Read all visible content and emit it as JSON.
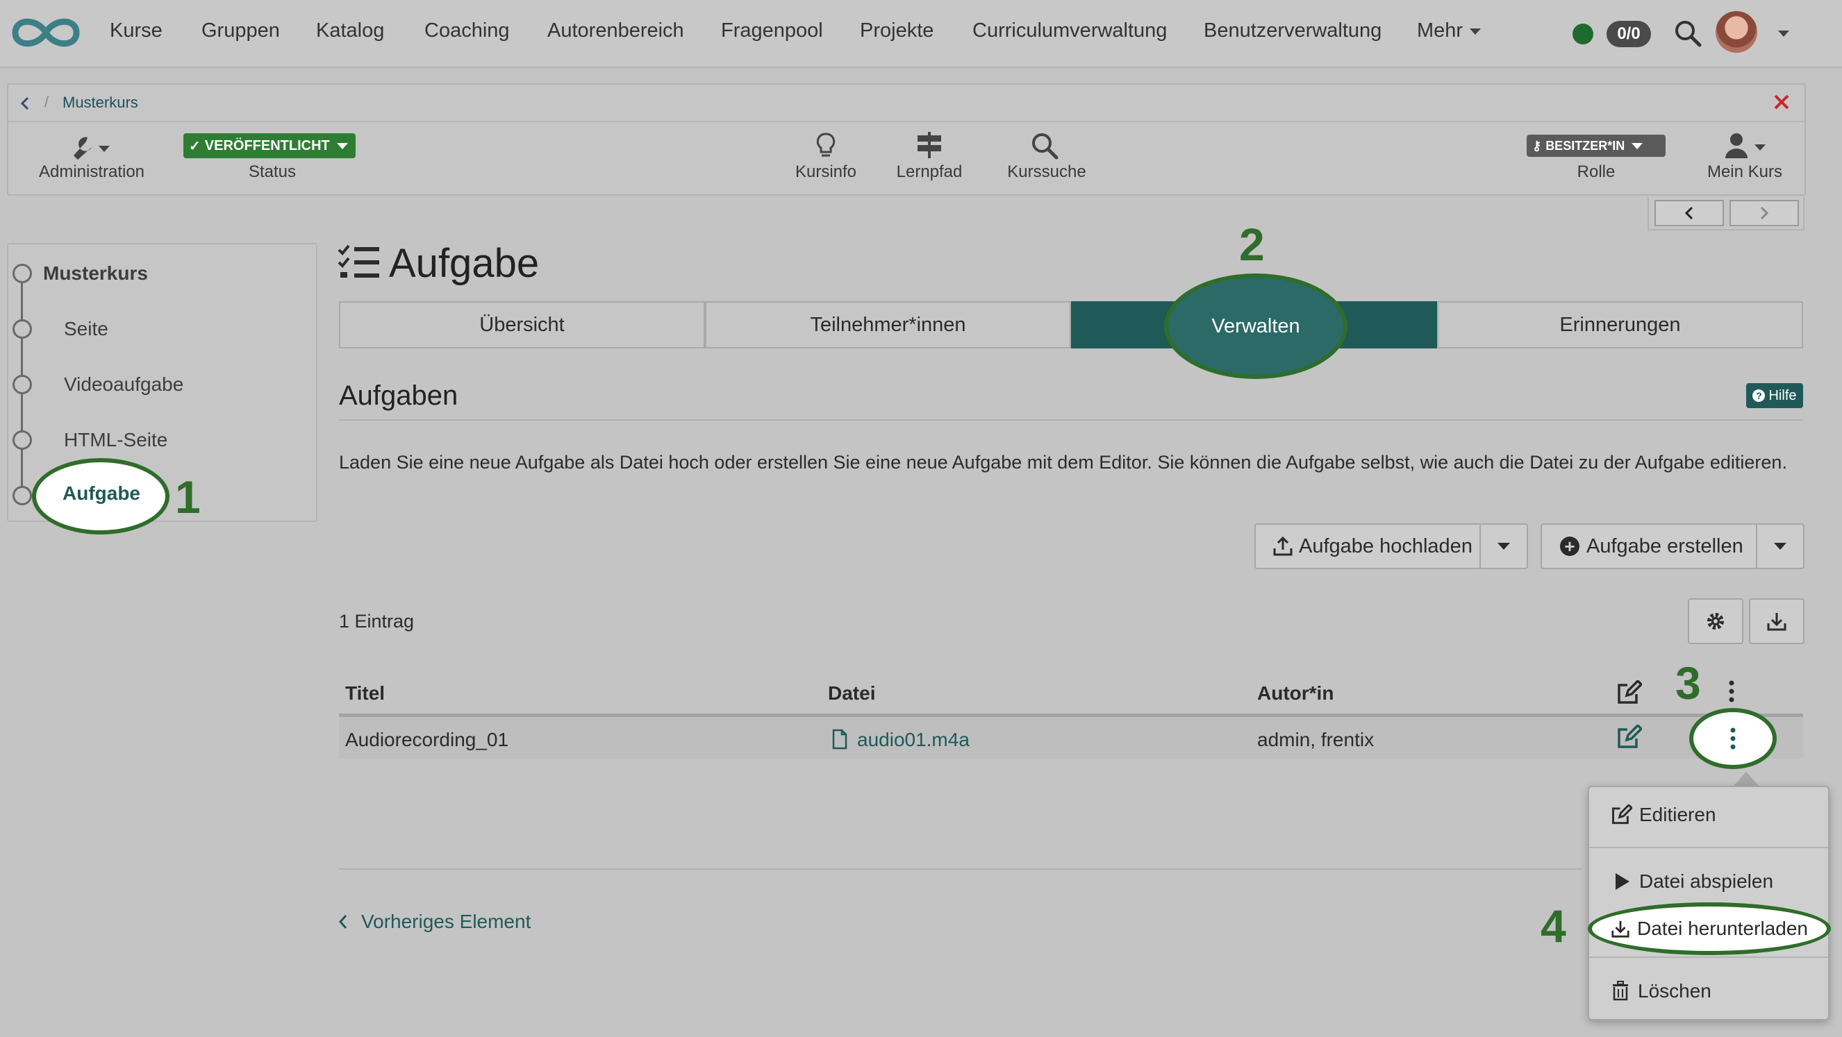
{
  "topnav": {
    "items": [
      "Kurse",
      "Gruppen",
      "Katalog",
      "Coaching",
      "Autorenbereich",
      "Fragenpool",
      "Projekte",
      "Curriculumverwaltung",
      "Benutzerverwaltung"
    ],
    "more_label": "Mehr",
    "counter": "0/0",
    "status_color": "#1e6b2e"
  },
  "breadcrumb": {
    "course": "Musterkurs"
  },
  "toolbar": {
    "administration": "Administration",
    "status_badge": "VERÖFFENTLICHT",
    "status_label": "Status",
    "kursinfo": "Kursinfo",
    "lernpfad": "Lernpfad",
    "kurssuche": "Kurssuche",
    "role_badge": "BESITZER*IN",
    "role_label": "Rolle",
    "mein_kurs": "Mein Kurs"
  },
  "menu": {
    "root": "Musterkurs",
    "items": [
      "Seite",
      "Videoaufgabe",
      "HTML-Seite",
      "Aufgabe"
    ]
  },
  "page": {
    "title": "Aufgabe",
    "tabs": [
      "Übersicht",
      "Teilnehmer*innen",
      "Verwalten",
      "Erinnerungen"
    ],
    "section_title": "Aufgaben",
    "help_label": "Hilfe",
    "description": "Laden Sie eine neue Aufgabe als Datei hoch oder erstellen Sie eine neue Aufgabe mit dem Editor. Sie können die Aufgabe selbst, wie auch die Datei zu der Aufgabe editieren.",
    "upload_button": "Aufgabe hochladen",
    "create_button": "Aufgabe erstellen",
    "entry_count": "1 Eintrag",
    "prev_element": "Vorheriges Element"
  },
  "table": {
    "columns": [
      "Titel",
      "Datei",
      "Autor*in"
    ],
    "rows": [
      {
        "title": "Audiorecording_01",
        "file": "audio01.m4a",
        "author": "admin, frentix"
      }
    ]
  },
  "dropdown": {
    "items": [
      "Editieren",
      "Datei abspielen",
      "Datei herunterladen",
      "Löschen"
    ]
  },
  "annotations": [
    "1",
    "2",
    "3",
    "4"
  ],
  "colors": {
    "accent": "#1f5a58",
    "annotation": "#2f6d2a",
    "badge_green": "#2e7d32",
    "close_red": "#c62828",
    "logo": "#3d7f86"
  }
}
